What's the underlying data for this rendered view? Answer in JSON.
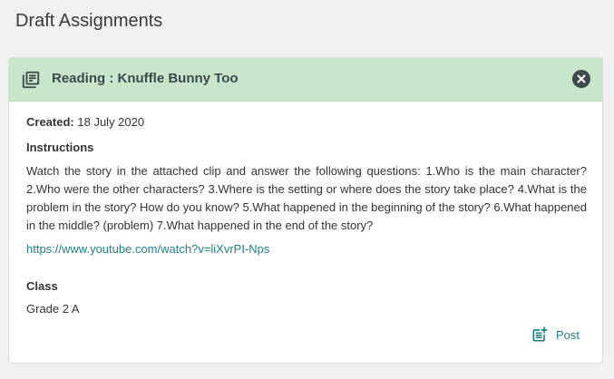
{
  "page": {
    "title": "Draft Assignments"
  },
  "assignment": {
    "title": "Reading : Knuffle Bunny Too",
    "header_color": "#c8e6c9",
    "created_label": "Created:",
    "created_value": "18 July 2020",
    "instructions_label": "Instructions",
    "instructions_text": "Watch the story in the attached clip and answer the following questions: 1.Who is the main character? 2.Who were the other characters? 3.Where is the setting or where does the story take place? 4.What is the problem in the story? How do you know? 5.What happened in the beginning of the story? 6.What happened in the middle? (problem) 7.What happened in the end of the story?",
    "link": "https://www.youtube.com/watch?v=liXvrPI-Nps",
    "class_label": "Class",
    "class_value": "Grade 2 A",
    "post_label": "Post",
    "accent_color": "#1f7f86"
  },
  "icons": {
    "header": "library-books-icon",
    "close": "close-circle-icon",
    "post": "post-add-icon"
  }
}
